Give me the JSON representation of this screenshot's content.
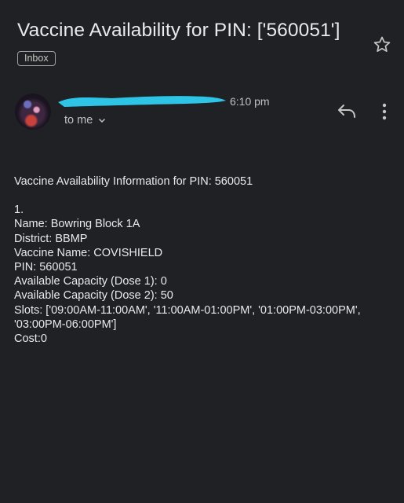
{
  "email": {
    "subject": "Vaccine Availability for PIN: ['560051']",
    "label": "Inbox",
    "time": "6:10 pm",
    "recipient": "to me"
  },
  "icons": {
    "star": "star-outline-icon",
    "reply": "reply-icon",
    "more": "more-vert-icon",
    "chevron": "chevron-down-icon"
  },
  "body": {
    "intro": "Vaccine Availability Information for PIN: 560051",
    "index": "1.",
    "name": "Name: Bowring Block 1A",
    "district": "District: BBMP",
    "vaccine": "Vaccine Name: COVISHIELD",
    "pin": "PIN: 560051",
    "dose1": "Available Capacity (Dose 1): 0",
    "dose2": "Available Capacity (Dose 2): 50",
    "slots": "Slots: ['09:00AM-11:00AM', '11:00AM-01:00PM', '01:00PM-03:00PM', '03:00PM-06:00PM']",
    "cost": "Cost:0"
  },
  "colors": {
    "background": "#202124",
    "text": "#e8eaed",
    "secondary_text": "#bdc1c6",
    "redaction": "#2ec4e6"
  }
}
